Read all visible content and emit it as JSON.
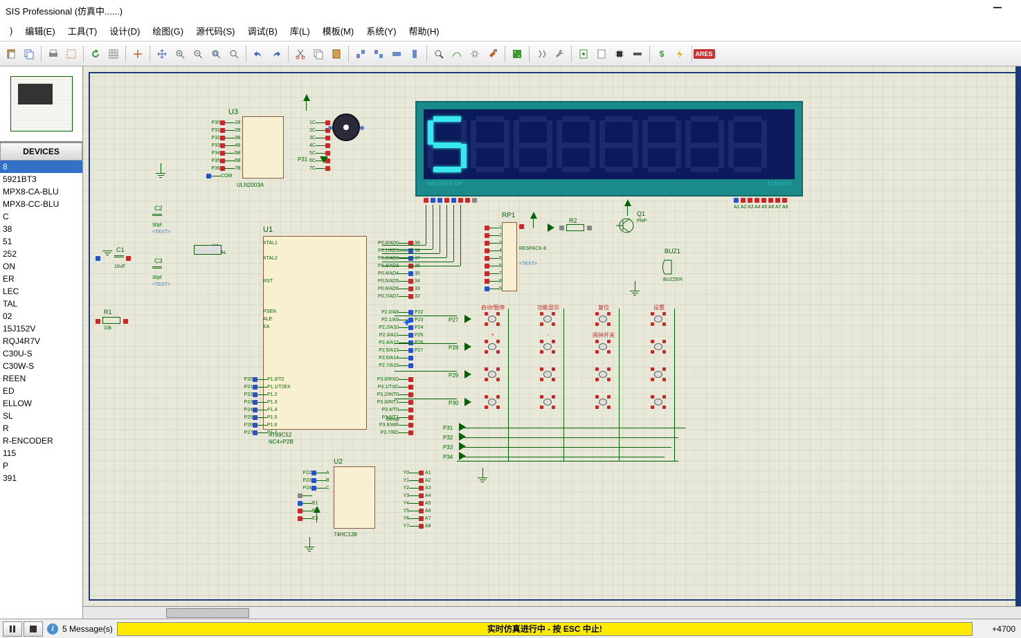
{
  "title": "SIS Professional (仿真中......)",
  "menu": [
    "编辑(E)",
    "工具(T)",
    "设计(D)",
    "绘图(G)",
    "源代码(S)",
    "调试(B)",
    "库(L)",
    "模板(M)",
    "系统(Y)",
    "帮助(H)"
  ],
  "devices_header": "DEVICES",
  "devices": [
    "8",
    "5921BT3",
    "MPX8-CA-BLU",
    "MPX8-CC-BLU",
    "C",
    "38",
    "51",
    "252",
    "ON",
    "ER",
    "",
    "LEC",
    "TAL",
    "02",
    "15J152V",
    "RQJ4R7V",
    "C30U-S",
    "C30W-S",
    "REEN",
    "ED",
    "ELLOW",
    "SL",
    "R",
    "R-ENCODER",
    "115",
    "P",
    "391"
  ],
  "devices_selected": 0,
  "status_messages": "5 Message(s)",
  "status_running": "实时仿真进行中 - 按 ESC 中止!",
  "status_coord": "+4700",
  "display": {
    "label_left": "ABCDEFG  DP",
    "label_right": "12345678",
    "digits": [
      [
        1,
        0,
        1,
        1,
        0,
        1,
        1
      ],
      [
        0,
        0,
        0,
        0,
        0,
        0,
        0
      ],
      [
        0,
        0,
        0,
        0,
        0,
        0,
        0
      ],
      [
        0,
        0,
        0,
        0,
        0,
        0,
        0
      ],
      [
        0,
        0,
        0,
        0,
        0,
        0,
        0
      ],
      [
        0,
        0,
        0,
        0,
        0,
        0,
        0
      ],
      [
        0,
        0,
        0,
        0,
        0,
        0,
        0
      ],
      [
        0,
        0,
        0,
        0,
        0,
        0,
        0
      ]
    ]
  },
  "components": {
    "u1": "U1",
    "u1_chip": "AT89C52",
    "u1_sub": "NC4=P2B",
    "u2": "U2",
    "u2_chip": "74HC138",
    "u3": "U3",
    "u3_chip": "ULN2003A",
    "rp1": "RP1",
    "rp1_type": "RESPACK-8",
    "r1": "R1",
    "r1_val": "10k",
    "r2": "R2",
    "c1": "C1",
    "c1_val": "10uF",
    "c2": "C2",
    "c2_val": "30pf",
    "c3": "C3",
    "c3_val": "30pf",
    "x1": "X1",
    "x1_type": "CRYSTAL",
    "q1": "Q1",
    "q1_type": "PNP",
    "buz1": "BUZ1",
    "buz1_type": "BUZZER"
  },
  "u1_pins_left": [
    "XTAL1",
    "",
    "XTAL2",
    "",
    "",
    "RST",
    "",
    "",
    "",
    "PSEN",
    "ALE",
    "EA"
  ],
  "u1_pins_left_bottom": [
    "P1.0/T2",
    "P1.1/T2EX",
    "P1.2",
    "P1.3",
    "P1.4",
    "P1.5",
    "P1.6",
    "P1.7"
  ],
  "u1_pins_left_nums": [
    "P20",
    "P21",
    "P22",
    "P23",
    "P24",
    "P25",
    "P26",
    "P27"
  ],
  "u1_pins_right_top": [
    "P0.0/AD0",
    "P0.1/AD1",
    "P0.2/AD2",
    "P0.3/AD3",
    "P0.4/AD4",
    "P0.5/AD5",
    "P0.6/AD6",
    "P0.7/AD7"
  ],
  "u1_pins_right_mid": [
    "P2.0/A8",
    "P2.1/A9",
    "P2.2/A10",
    "P2.3/A11",
    "P2.4/A12",
    "P2.5/A13",
    "P2.6/A14",
    "P2.7/A15"
  ],
  "u1_pins_right_mid_nums": [
    "P22",
    "P23",
    "P24",
    "P25",
    "P26",
    "P27",
    "",
    ""
  ],
  "u1_pins_right_bot": [
    "P3.0/RXD",
    "P3.1/TXD",
    "P3.2/INT0",
    "P3.3/INT1",
    "P3.4/T0",
    "P3.5/T1",
    "P3.6/WR",
    "P3.7/RD"
  ],
  "u3_pins_left": [
    "1B",
    "2B",
    "3B",
    "4B",
    "5B",
    "6B",
    "7B",
    "COM"
  ],
  "u3_pins_right": [
    "1C",
    "2C",
    "3C",
    "4C",
    "5C",
    "6C",
    "7C"
  ],
  "u3_nums_left": [
    "P30",
    "P31",
    "P32",
    "P33",
    "P34",
    "P35",
    "P36"
  ],
  "u2_pins_left": [
    "A",
    "B",
    "C",
    "",
    "E1",
    "E2",
    "E3"
  ],
  "u2_pins_right": [
    "Y0",
    "Y1",
    "Y2",
    "Y3",
    "Y4",
    "Y5",
    "Y6",
    "Y7"
  ],
  "u2_nums_left": [
    "P22",
    "P23",
    "P24"
  ],
  "u2_nums_right": [
    "A1",
    "A2",
    "A3",
    "A4",
    "A5",
    "A6",
    "A7",
    "A8"
  ],
  "button_labels": [
    "启动/暂停",
    "功能显示",
    "复位",
    "设置",
    "+",
    "-",
    "闹钟开关",
    ""
  ],
  "row_labels": [
    "P27",
    "P28",
    "P29",
    "P30",
    "",
    "P31",
    "P32",
    "P33",
    "P34"
  ],
  "text_ext": "<TEXT>",
  "beep_label": "Beep",
  "p31_label": "P31"
}
